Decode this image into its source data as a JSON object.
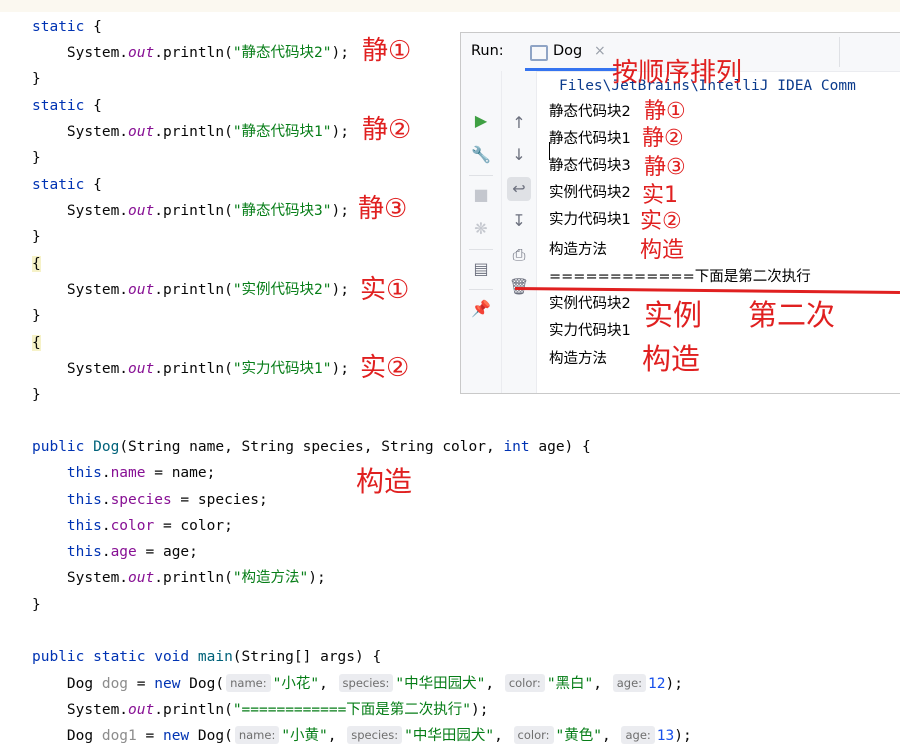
{
  "code_lines": [
    {
      "id": "l1",
      "parts": [
        {
          "t": "static",
          "c": "kw"
        },
        {
          "t": " {"
        }
      ]
    },
    {
      "id": "l2",
      "parts": [
        {
          "t": "    System."
        },
        {
          "t": "out",
          "c": "st"
        },
        {
          "t": ".println("
        },
        {
          "t": "\"静态代码块2\"",
          "c": "str"
        },
        {
          "t": ");"
        }
      ]
    },
    {
      "id": "l3",
      "parts": [
        {
          "t": "}"
        }
      ]
    },
    {
      "id": "l4",
      "parts": [
        {
          "t": "static",
          "c": "kw"
        },
        {
          "t": " {"
        }
      ]
    },
    {
      "id": "l5",
      "parts": [
        {
          "t": "    System."
        },
        {
          "t": "out",
          "c": "st"
        },
        {
          "t": ".println("
        },
        {
          "t": "\"静态代码块1\"",
          "c": "str"
        },
        {
          "t": ");"
        }
      ]
    },
    {
      "id": "l6",
      "parts": [
        {
          "t": "}"
        }
      ]
    },
    {
      "id": "l7",
      "parts": [
        {
          "t": "static",
          "c": "kw"
        },
        {
          "t": " {"
        }
      ]
    },
    {
      "id": "l8",
      "parts": [
        {
          "t": "    System."
        },
        {
          "t": "out",
          "c": "st"
        },
        {
          "t": ".println("
        },
        {
          "t": "\"静态代码块3\"",
          "c": "str"
        },
        {
          "t": ");"
        }
      ]
    },
    {
      "id": "l9",
      "parts": [
        {
          "t": "}"
        }
      ]
    },
    {
      "id": "l10",
      "parts": [
        {
          "t": "{",
          "c": "brace-hl"
        }
      ]
    },
    {
      "id": "l11",
      "parts": [
        {
          "t": "    System."
        },
        {
          "t": "out",
          "c": "st"
        },
        {
          "t": ".println("
        },
        {
          "t": "\"实例代码块2\"",
          "c": "str"
        },
        {
          "t": ");"
        }
      ]
    },
    {
      "id": "l12",
      "parts": [
        {
          "t": "}"
        }
      ]
    },
    {
      "id": "l13",
      "parts": [
        {
          "t": "{",
          "c": "brace-hl"
        }
      ]
    },
    {
      "id": "l14",
      "parts": [
        {
          "t": "    System."
        },
        {
          "t": "out",
          "c": "st"
        },
        {
          "t": ".println("
        },
        {
          "t": "\"实力代码块1\"",
          "c": "str"
        },
        {
          "t": ");"
        }
      ]
    },
    {
      "id": "l15",
      "parts": [
        {
          "t": "}"
        }
      ]
    },
    {
      "id": "l16",
      "parts": [
        {
          "t": "public",
          "c": "kw"
        },
        {
          "t": " "
        },
        {
          "t": "Dog",
          "c": "cls"
        },
        {
          "t": "(String name, String species, String color, "
        },
        {
          "t": "int",
          "c": "kw"
        },
        {
          "t": " age) {"
        }
      ]
    },
    {
      "id": "l17",
      "parts": [
        {
          "t": "    "
        },
        {
          "t": "this",
          "c": "kw"
        },
        {
          "t": "."
        },
        {
          "t": "name",
          "c": "fld"
        },
        {
          "t": " = name;"
        }
      ]
    },
    {
      "id": "l18",
      "parts": [
        {
          "t": "    "
        },
        {
          "t": "this",
          "c": "kw"
        },
        {
          "t": "."
        },
        {
          "t": "species",
          "c": "fld"
        },
        {
          "t": " = species;"
        }
      ]
    },
    {
      "id": "l19",
      "parts": [
        {
          "t": "    "
        },
        {
          "t": "this",
          "c": "kw"
        },
        {
          "t": "."
        },
        {
          "t": "color",
          "c": "fld"
        },
        {
          "t": " = color;"
        }
      ]
    },
    {
      "id": "l20",
      "parts": [
        {
          "t": "    "
        },
        {
          "t": "this",
          "c": "kw"
        },
        {
          "t": "."
        },
        {
          "t": "age",
          "c": "fld"
        },
        {
          "t": " = age;"
        }
      ]
    },
    {
      "id": "l21",
      "parts": [
        {
          "t": "    System."
        },
        {
          "t": "out",
          "c": "st"
        },
        {
          "t": ".println("
        },
        {
          "t": "\"构造方法\"",
          "c": "str"
        },
        {
          "t": ");"
        }
      ]
    },
    {
      "id": "l22",
      "parts": [
        {
          "t": "}"
        }
      ]
    },
    {
      "id": "l23",
      "parts": [
        {
          "t": "public static void",
          "c": "kw"
        },
        {
          "t": " "
        },
        {
          "t": "main",
          "c": "cls"
        },
        {
          "t": "(String[] args) {"
        }
      ]
    },
    {
      "id": "l24",
      "parts": [
        {
          "t": "    Dog "
        },
        {
          "t": "dog",
          "c": "var-gray"
        },
        {
          "t": " = "
        },
        {
          "t": "new",
          "c": "kw"
        },
        {
          "t": " Dog("
        },
        {
          "h": "name:"
        },
        {
          "t": "\"小花\"",
          "c": "str"
        },
        {
          "t": ", "
        },
        {
          "h": "species:"
        },
        {
          "t": "\"中华田园犬\"",
          "c": "str"
        },
        {
          "t": ", "
        },
        {
          "h": "color:"
        },
        {
          "t": "\"黑白\"",
          "c": "str"
        },
        {
          "t": ", "
        },
        {
          "h": "age:"
        },
        {
          "t": "12",
          "c": "num"
        },
        {
          "t": ");"
        }
      ]
    },
    {
      "id": "l25",
      "parts": [
        {
          "t": "    System."
        },
        {
          "t": "out",
          "c": "st"
        },
        {
          "t": ".println("
        },
        {
          "t": "\"============下面是第二次执行\"",
          "c": "str"
        },
        {
          "t": ");"
        }
      ]
    },
    {
      "id": "l26",
      "parts": [
        {
          "t": "    Dog "
        },
        {
          "t": "dog1",
          "c": "var-gray"
        },
        {
          "t": " = "
        },
        {
          "t": "new",
          "c": "kw"
        },
        {
          "t": " Dog("
        },
        {
          "h": "name:"
        },
        {
          "t": "\"小黄\"",
          "c": "str"
        },
        {
          "t": ", "
        },
        {
          "h": "species:"
        },
        {
          "t": "\"中华田园犬\"",
          "c": "str"
        },
        {
          "t": ", "
        },
        {
          "h": "color:"
        },
        {
          "t": "\"黄色\"",
          "c": "str"
        },
        {
          "t": ", "
        },
        {
          "h": "age:"
        },
        {
          "t": "13",
          "c": "num"
        },
        {
          "t": ");"
        }
      ]
    }
  ],
  "annotations": {
    "a_static1": "静①",
    "a_static2": "静②",
    "a_static3": "静③",
    "a_inst1": "实①",
    "a_inst2": "实②",
    "a_ctor": "构造",
    "a_order": "按顺序排列",
    "c_static1": "静①",
    "c_static2": "静②",
    "c_static3": "静③",
    "c_inst1": "实1",
    "c_inst2": "实②",
    "c_ctor": "构造",
    "c_second_inst": "实例",
    "c_second": "第二次",
    "c_second_ctor": "构造"
  },
  "run_panel": {
    "label": "Run:",
    "tab_name": "Dog",
    "tab_close": "×",
    "path_line": "Files\\JetBrains\\IntelliJ IDEA Comm",
    "output": [
      "静态代码块2",
      "静态代码块1",
      "静态代码块3",
      "实例代码块2",
      "实力代码块1",
      "构造方法",
      "============下面是第二次执行",
      "实例代码块2",
      "实力代码块1",
      "构造方法"
    ],
    "toolbar_icons": [
      "run-icon",
      "wrench-icon",
      "stop-icon",
      "debug-icon",
      "layout-icon",
      "pin-icon"
    ],
    "side_icons": [
      "arrow-up-icon",
      "arrow-down-icon",
      "soft-wrap-icon",
      "scroll-end-icon",
      "print-icon",
      "trash-icon"
    ]
  },
  "colors": {
    "annotation": "#e02020",
    "keyword": "#0033b3",
    "string": "#067d17",
    "field": "#871094"
  }
}
